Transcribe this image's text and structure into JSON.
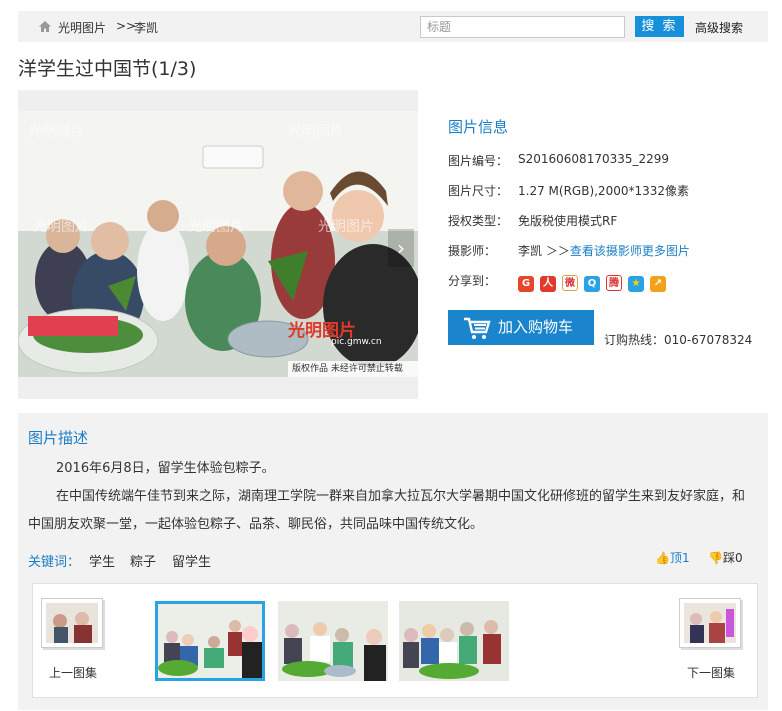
{
  "breadcrumb": {
    "home": "光明图片",
    "separator": ">>",
    "current": "李凯"
  },
  "search": {
    "placeholder": "标题",
    "value": "",
    "button": "搜 索",
    "advanced": "高级搜索"
  },
  "page_title": "洋学生过中国节(1/3)",
  "photo": {
    "watermark_logo": "光明图片",
    "watermark_url": "pic.gmw.cn",
    "watermark_copy": "版权作品  未经许可禁止转载"
  },
  "info": {
    "title": "图片信息",
    "rows": [
      {
        "label": "图片编号：",
        "value": "S20160608170335_2299"
      },
      {
        "label": "图片尺寸：",
        "value": "1.27 M(RGB),2000*1332像素"
      },
      {
        "label": "授权类型：",
        "value": "免版税使用模式RF"
      },
      {
        "label": "摄影师：",
        "value": "李凯 ＞＞",
        "more": "查看该摄影师更多图片"
      }
    ],
    "share_label": "分享到：",
    "share_icons": [
      "google-icon",
      "renren-icon",
      "weibo-icon",
      "qzone-icon",
      "tencent-weibo-icon",
      "favorite-star-icon",
      "link-icon"
    ],
    "cart_button": "加入购物车",
    "hotline": "订购热线：010-67078324"
  },
  "description": {
    "title": "图片描述",
    "paragraphs": [
      "2016年6月8日，留学生体验包粽子。",
      "在中国传统端午佳节到来之际，湖南理工学院一群来自加拿大拉瓦尔大学暑期中国文化研修班的留学生来到友好家庭，和中国朋友欢聚一堂，一起体验包粽子、品茶、聊民俗，共同品味中国传统文化。"
    ],
    "keywords_label": "关键词：",
    "keywords": [
      "学生",
      "粽子",
      "留学生"
    ],
    "up_label": "顶1",
    "down_label": "踩0"
  },
  "gallery": {
    "prev_label": "上一图集",
    "next_label": "下一图集",
    "thumb_count": 3,
    "active_index": 0
  },
  "colors": {
    "accent": "#1a84cc",
    "link": "#1a7ec4",
    "panel": "#f2f2f2",
    "active_border": "#29a3e3"
  }
}
